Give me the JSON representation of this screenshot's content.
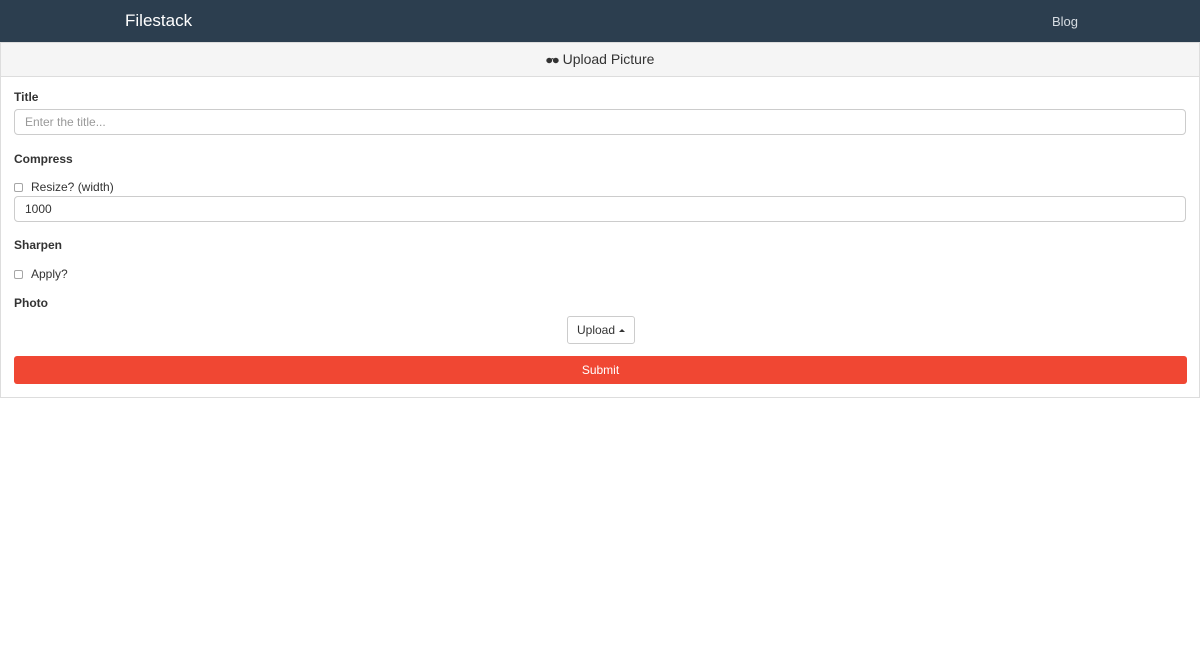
{
  "navbar": {
    "brand": "Filestack",
    "links": [
      {
        "label": "Blog"
      }
    ]
  },
  "panel": {
    "heading": "Upload Picture",
    "heading_icon": "glasses-icon"
  },
  "form": {
    "title": {
      "label": "Title",
      "placeholder": "Enter the title...",
      "value": ""
    },
    "compress": {
      "label": "Compress",
      "resize_label": "Resize? (width)",
      "resize_checked": false,
      "width_value": "1000"
    },
    "sharpen": {
      "label": "Sharpen",
      "apply_label": "Apply?",
      "apply_checked": false
    },
    "photo": {
      "label": "Photo",
      "upload_label": "Upload"
    },
    "submit_label": "Submit"
  },
  "colors": {
    "navbar_bg": "#2c3e4f",
    "submit_bg": "#f04733",
    "panel_heading_bg": "#f5f5f5"
  }
}
